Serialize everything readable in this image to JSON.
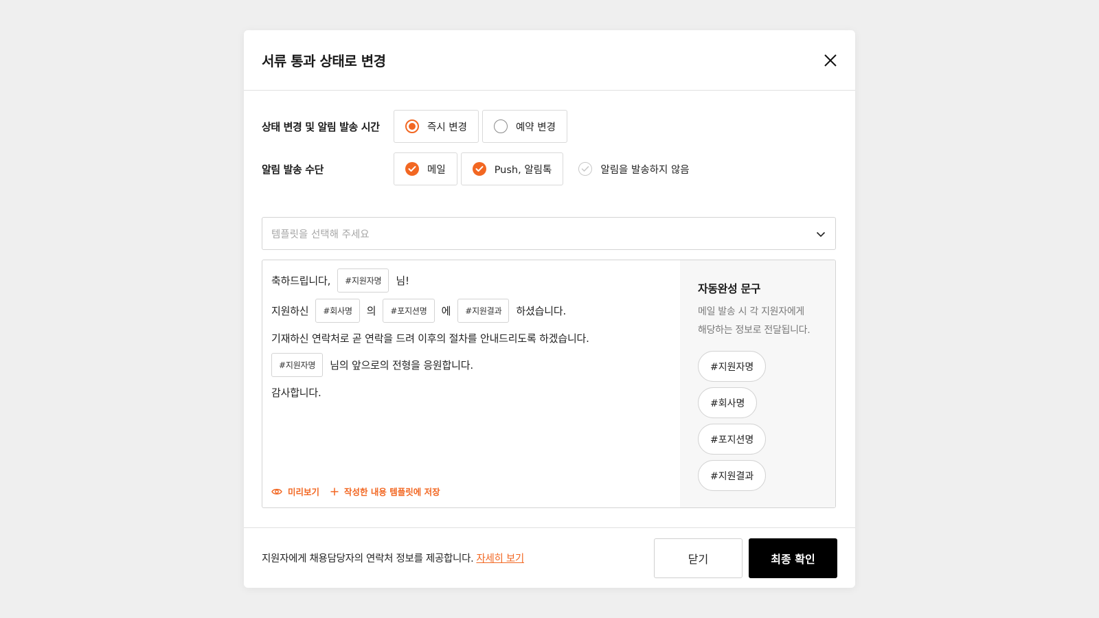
{
  "modal": {
    "title": "서류 통과 상태로 변경"
  },
  "timing": {
    "label": "상태 변경 및 알림 발송 시간",
    "options": [
      {
        "label": "즉시 변경",
        "selected": true
      },
      {
        "label": "예약 변경",
        "selected": false
      }
    ]
  },
  "channels": {
    "label": "알림 발송 수단",
    "options": [
      {
        "label": "메일",
        "checked": true
      },
      {
        "label": "Push, 알림톡",
        "checked": true
      },
      {
        "label": "알림을 발송하지 않음",
        "checked": false
      }
    ]
  },
  "template_select": {
    "placeholder": "템플릿을 선택해 주세요"
  },
  "editor": {
    "line1": {
      "pre": "축하드립니다,",
      "token": "#지원자명",
      "post": "님!"
    },
    "line2": {
      "pre": "지원하신",
      "token1": "#회사명",
      "mid1": "의",
      "token2": "#포지션명",
      "mid2": "에",
      "token3": "#지원결과",
      "post": "하셨습니다."
    },
    "line3": "기재하신 연락처로 곧 연락을 드려 이후의 절차를 안내드리도록 하겠습니다.",
    "line4": {
      "token": "#지원자명",
      "post": "님의 앞으로의 전형을 응원합니다."
    },
    "line5": "감사합니다.",
    "preview_label": "미리보기",
    "save_template_label": "작성한 내용 템플릿에 저장"
  },
  "autocomplete": {
    "title": "자동완성 문구",
    "desc_line1": "메일 발송 시 각 지원자에게",
    "desc_line2": "해당하는 정보로 전달됩니다.",
    "chips": [
      "#지원자명",
      "#회사명",
      "#포지션명",
      "#지원결과"
    ]
  },
  "footer": {
    "info": "지원자에게 채용담당자의 연락처 정보를 제공합니다.",
    "link": "자세히 보기",
    "close_label": "닫기",
    "confirm_label": "최종 확인"
  },
  "colors": {
    "accent": "#f26722",
    "primary_button": "#000000"
  }
}
